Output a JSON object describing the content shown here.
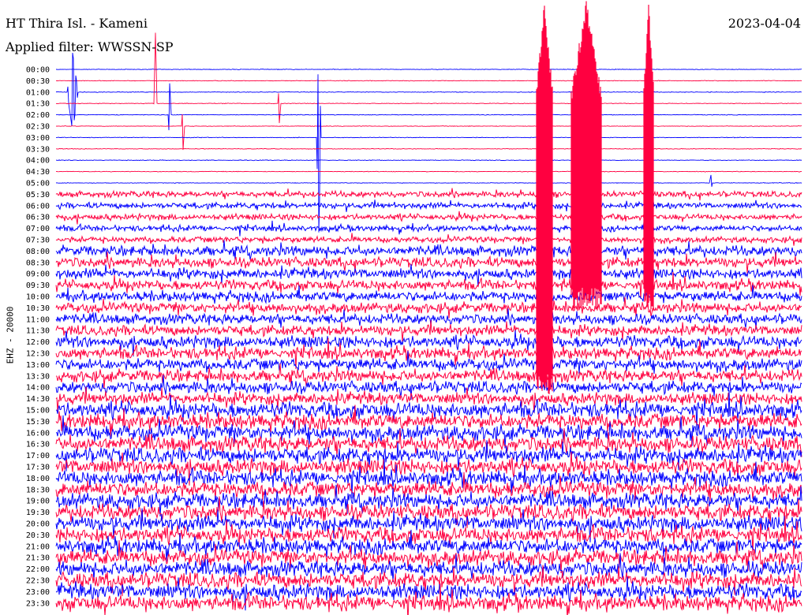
{
  "header": {
    "station": "HT Thira Isl. - Kameni",
    "filter": "Applied filter: WWSSN-SP",
    "date": "2023-04-04"
  },
  "channel_label": "EHZ - 20000",
  "colors": {
    "trace_a": "#ff0040",
    "trace_b": "#0000ff",
    "background": "#ffffff",
    "text": "#000000"
  },
  "chart_data": {
    "type": "line",
    "title": "HT Thira Isl. - Kameni",
    "subtitle": "Applied filter: WWSSN-SP",
    "ylabel": "EHZ - 20000",
    "row_labels": [
      "00:00",
      "00:30",
      "01:00",
      "01:30",
      "02:00",
      "02:30",
      "03:00",
      "03:30",
      "04:00",
      "04:30",
      "05:00",
      "05:30",
      "06:00",
      "06:30",
      "07:00",
      "07:30",
      "08:00",
      "08:30",
      "09:00",
      "09:30",
      "10:00",
      "10:30",
      "11:00",
      "11:30",
      "12:00",
      "12:30",
      "13:00",
      "13:30",
      "14:00",
      "14:30",
      "15:00",
      "15:30",
      "16:00",
      "16:30",
      "17:00",
      "17:30",
      "18:00",
      "18:30",
      "19:00",
      "19:30",
      "20:00",
      "20:30",
      "21:00",
      "21:30",
      "22:00",
      "22:30",
      "23:00",
      "23:30"
    ],
    "row_colors": [
      "#0000ff",
      "#ff0040"
    ],
    "grid": false,
    "legend": "none"
  }
}
